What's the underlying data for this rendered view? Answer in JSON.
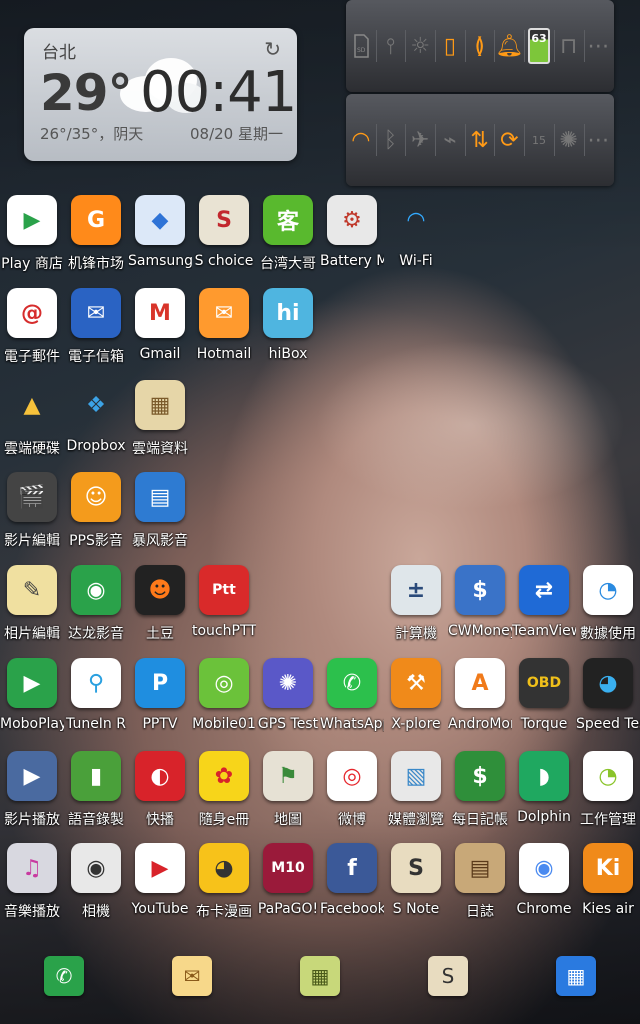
{
  "clock": {
    "city": "台北",
    "temp": "29°",
    "time": "00:41",
    "range": "26°/35°，阴天",
    "date": "08/20 星期一"
  },
  "toggles_row1": [
    "SD",
    "USB",
    "燈",
    "●",
    "震",
    "鈴",
    "63",
    "🔒",
    "•••"
  ],
  "toggles_row2": [
    "WiFi",
    "BT",
    "✈",
    "GPS",
    "數據",
    "同步",
    "15",
    "亮",
    "•••"
  ],
  "apps": [
    {
      "label": "Play 商店",
      "bg": "#ffffff",
      "fg": "#2aa24a",
      "glyph": "▶"
    },
    {
      "label": "机锋市场",
      "bg": "#ff8a1a",
      "fg": "#ffffff",
      "glyph": "G"
    },
    {
      "label": "Samsung",
      "bg": "#dce8f8",
      "fg": "#2f73d6",
      "glyph": "◆"
    },
    {
      "label": "S choice",
      "bg": "#e9e3d3",
      "fg": "#c2272d",
      "glyph": "S"
    },
    {
      "label": "台湾大哥",
      "bg": "#59b92e",
      "fg": "#ffffff",
      "glyph": "客"
    },
    {
      "label": "Battery M",
      "bg": "#e8e8e8",
      "fg": "#c0392b",
      "glyph": "⚙"
    },
    {
      "label": "Wi-Fi",
      "bg": "transparent",
      "fg": "#33aaff",
      "glyph": "◠"
    },
    {
      "label": "電子郵件",
      "bg": "#ffffff",
      "fg": "#d62d2d",
      "glyph": "@"
    },
    {
      "label": "電子信箱",
      "bg": "#2a63c3",
      "fg": "#ffffff",
      "glyph": "✉"
    },
    {
      "label": "Gmail",
      "bg": "#ffffff",
      "fg": "#d8342a",
      "glyph": "M"
    },
    {
      "label": "Hotmail",
      "bg": "#ff9a2e",
      "fg": "#ffffff",
      "glyph": "✉"
    },
    {
      "label": "hiBox",
      "bg": "#4fb5e0",
      "fg": "#ffffff",
      "glyph": "hi"
    },
    {
      "label": "雲端硬碟",
      "bg": "transparent",
      "fg": "#f7c23b",
      "glyph": "▲"
    },
    {
      "label": "Dropbox",
      "bg": "transparent",
      "fg": "#3ca3e6",
      "glyph": "❖"
    },
    {
      "label": "雲端資料",
      "bg": "#e6d6a8",
      "fg": "#7a5a2a",
      "glyph": "▦"
    },
    {
      "label": "影片編輯",
      "bg": "#444444",
      "fg": "#ffffff",
      "glyph": "🎬"
    },
    {
      "label": "PPS影音",
      "bg": "#f49b1c",
      "fg": "#ffffff",
      "glyph": "☺"
    },
    {
      "label": "暴风影音",
      "bg": "#2e7bd2",
      "fg": "#ffffff",
      "glyph": "▤"
    },
    {
      "label": "相片編輯",
      "bg": "#f0e0a0",
      "fg": "#444444",
      "glyph": "✎"
    },
    {
      "label": "达龙影音",
      "bg": "#2aa24a",
      "fg": "#ffffff",
      "glyph": "◉"
    },
    {
      "label": "土豆",
      "bg": "#222222",
      "fg": "#ff7a1a",
      "glyph": "☻"
    },
    {
      "label": "touchPTT",
      "bg": "#d92a2a",
      "fg": "#ffffff",
      "glyph": "Ptt"
    },
    {
      "label": "計算機",
      "bg": "#dfe6ea",
      "fg": "#2a4a7a",
      "glyph": "±"
    },
    {
      "label": "CWMoney",
      "bg": "#3a73c8",
      "fg": "#ffffff",
      "glyph": "$"
    },
    {
      "label": "TeamViewer",
      "bg": "#1f6ad6",
      "fg": "#ffffff",
      "glyph": "⇄"
    },
    {
      "label": "數據使用",
      "bg": "#ffffff",
      "fg": "#2a8ae0",
      "glyph": "◔"
    },
    {
      "label": "MoboPlayer",
      "bg": "#2aa24a",
      "fg": "#ffffff",
      "glyph": "▶"
    },
    {
      "label": "TuneIn R",
      "bg": "#ffffff",
      "fg": "#2aa0e0",
      "glyph": "⚲"
    },
    {
      "label": "PPTV",
      "bg": "#1f8ee0",
      "fg": "#ffffff",
      "glyph": "P"
    },
    {
      "label": "Mobile01",
      "bg": "#6bc23a",
      "fg": "#ffffff",
      "glyph": "◎"
    },
    {
      "label": "GPS Test",
      "bg": "#5a58c8",
      "fg": "#ffffff",
      "glyph": "✺"
    },
    {
      "label": "WhatsApp",
      "bg": "#2cc04c",
      "fg": "#ffffff",
      "glyph": "✆"
    },
    {
      "label": "X-plore",
      "bg": "#f08a1a",
      "fg": "#ffffff",
      "glyph": "⚒"
    },
    {
      "label": "AndroMoney",
      "bg": "#ffffff",
      "fg": "#f07a1a",
      "glyph": "A"
    },
    {
      "label": "Torque",
      "bg": "#333333",
      "fg": "#f0c01a",
      "glyph": "OBD"
    },
    {
      "label": "Speed Test",
      "bg": "#222222",
      "fg": "#3ab0f0",
      "glyph": "◕"
    },
    {
      "label": "影片播放",
      "bg": "#4a6aa0",
      "fg": "#ffffff",
      "glyph": "▶"
    },
    {
      "label": "語音錄製",
      "bg": "#4aa03a",
      "fg": "#ffffff",
      "glyph": "▮"
    },
    {
      "label": "快播",
      "bg": "#d8232a",
      "fg": "#ffffff",
      "glyph": "◐"
    },
    {
      "label": "隨身e冊",
      "bg": "#f7d51a",
      "fg": "#d8232a",
      "glyph": "✿"
    },
    {
      "label": "地圖",
      "bg": "#e6e1d4",
      "fg": "#3a8a3a",
      "glyph": "⚑"
    },
    {
      "label": "微博",
      "bg": "#ffffff",
      "fg": "#e6262c",
      "glyph": "◎"
    },
    {
      "label": "媒體瀏覽",
      "bg": "#e8e8e8",
      "fg": "#3a88c8",
      "glyph": "▧"
    },
    {
      "label": "每日記帳",
      "bg": "#2f8f3a",
      "fg": "#ffffff",
      "glyph": "$"
    },
    {
      "label": "Dolphin",
      "bg": "#1fa860",
      "fg": "#ffffff",
      "glyph": "◗"
    },
    {
      "label": "工作管理",
      "bg": "#ffffff",
      "fg": "#8ac42a",
      "glyph": "◔"
    },
    {
      "label": "音樂播放",
      "bg": "#d8d8e0",
      "fg": "#c83aa0",
      "glyph": "♫"
    },
    {
      "label": "相機",
      "bg": "#e8e8e8",
      "fg": "#333333",
      "glyph": "◉"
    },
    {
      "label": "YouTube",
      "bg": "#ffffff",
      "fg": "#d8232a",
      "glyph": "▶"
    },
    {
      "label": "布卡漫画",
      "bg": "#f7c21a",
      "fg": "#333333",
      "glyph": "◕"
    },
    {
      "label": "PaPaGO!",
      "bg": "#9a1a3a",
      "fg": "#ffffff",
      "glyph": "M10"
    },
    {
      "label": "Facebook",
      "bg": "#3b5998",
      "fg": "#ffffff",
      "glyph": "f"
    },
    {
      "label": "S Note",
      "bg": "#e8dcc0",
      "fg": "#333333",
      "glyph": "S"
    },
    {
      "label": "日誌",
      "bg": "#c8a878",
      "fg": "#5a3a1a",
      "glyph": "▤"
    },
    {
      "label": "Chrome",
      "bg": "#ffffff",
      "fg": "#4a8af0",
      "glyph": "◉"
    },
    {
      "label": "Kies air",
      "bg": "#f08a1a",
      "fg": "#ffffff",
      "glyph": "Ki"
    }
  ],
  "dock": [
    {
      "name": "phone-icon",
      "bg": "#2aa24a",
      "fg": "#ffffff",
      "glyph": "✆"
    },
    {
      "name": "messaging-icon",
      "bg": "#f7d88a",
      "fg": "#8a5a1a",
      "glyph": "✉"
    },
    {
      "name": "calendar-icon",
      "bg": "#c8d87a",
      "fg": "#4a5a1a",
      "glyph": "▦"
    },
    {
      "name": "snote-icon",
      "bg": "#e8dcc0",
      "fg": "#333333",
      "glyph": "S"
    },
    {
      "name": "app-drawer-icon",
      "bg": "#2a7ae0",
      "fg": "#ffffff",
      "glyph": "▦"
    }
  ]
}
